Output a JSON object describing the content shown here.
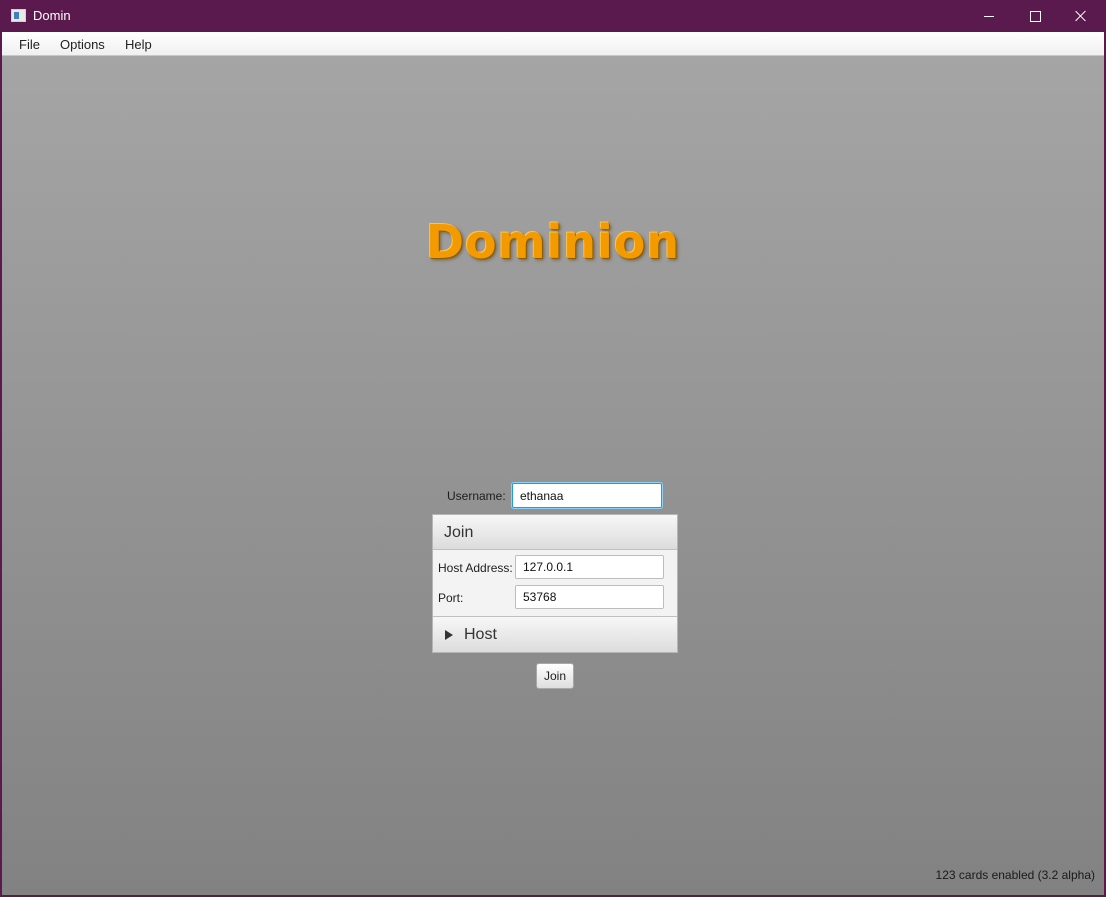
{
  "window": {
    "title": "Domin",
    "title_bar_color": "#5a1a4e",
    "controls": [
      "minimize-icon",
      "maximize-icon",
      "close-icon"
    ]
  },
  "menubar": {
    "items": [
      {
        "label": "File"
      },
      {
        "label": "Options"
      },
      {
        "label": "Help"
      }
    ]
  },
  "main": {
    "logo_text": "Dominion",
    "logo_color": "#f39a00",
    "username": {
      "label": "Username:",
      "value": "ethanaa"
    },
    "join_pane": {
      "title": "Join",
      "expanded": true,
      "host_address": {
        "label": "Host Address:",
        "value": "127.0.0.1"
      },
      "port": {
        "label": "Port:",
        "value": "53768"
      }
    },
    "host_pane": {
      "title": "Host",
      "expanded": false,
      "icon": "triangle-right-icon"
    },
    "join_button_label": "Join"
  },
  "status": {
    "text": "123 cards enabled (3.2 alpha)"
  }
}
